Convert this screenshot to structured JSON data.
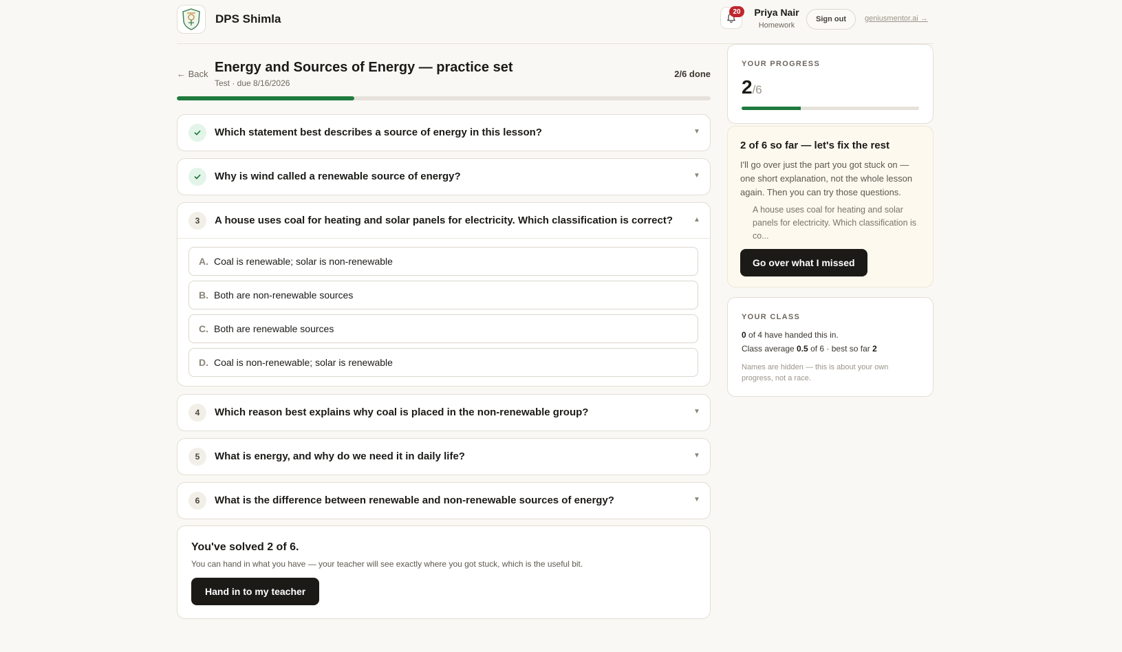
{
  "header": {
    "school_name": "DPS Shimla",
    "notifications_count": "20",
    "user_name": "Priya Nair",
    "user_role": "Homework",
    "sign_out_label": "Sign out",
    "brand_link": "geniusmentor.ai →"
  },
  "assignment": {
    "back_label": "← Back",
    "title": "Energy and Sources of Energy — practice set",
    "subtitle": "Test · due 8/16/2026",
    "done_label": "2/6 done",
    "progress_fraction": 0.333
  },
  "questions": [
    {
      "number": "1",
      "status": "correct",
      "text": "Which statement best describes a source of energy in this lesson?",
      "expanded": false
    },
    {
      "number": "2",
      "status": "correct",
      "text": "Why is wind called a renewable source of energy?",
      "expanded": false
    },
    {
      "number": "3",
      "status": "open",
      "text": "A house uses coal for heating and solar panels for electricity. Which classification is correct?",
      "expanded": true,
      "options": [
        {
          "letter": "A.",
          "text": "Coal is renewable; solar is non-renewable"
        },
        {
          "letter": "B.",
          "text": "Both are non-renewable sources"
        },
        {
          "letter": "C.",
          "text": "Both are renewable sources"
        },
        {
          "letter": "D.",
          "text": "Coal is non-renewable; solar is renewable"
        }
      ]
    },
    {
      "number": "4",
      "status": "open",
      "text": "Which reason best explains why coal is placed in the non-renewable group?",
      "expanded": false
    },
    {
      "number": "5",
      "status": "open",
      "text": "What is energy, and why do we need it in daily life?",
      "expanded": false
    },
    {
      "number": "6",
      "status": "open",
      "text": "What is the difference between renewable and non-renewable sources of energy?",
      "expanded": false
    }
  ],
  "summary": {
    "title": "You've solved 2 of 6.",
    "text": "You can hand in what you have — your teacher will see exactly where you got stuck, which is the useful bit.",
    "button_label": "Hand in to my teacher"
  },
  "progress_panel": {
    "label": "YOUR PROGRESS",
    "value": "2",
    "total": "/6",
    "fraction": 0.333
  },
  "help_panel": {
    "title": "2 of 6 so far — let's fix the rest",
    "text": "I'll go over just the part you got stuck on — one short explanation, not the whole lesson again. Then you can try those questions.",
    "quote": "A house uses coal for heating and solar panels for electricity. Which classification is co...",
    "button_label": "Go over what I missed"
  },
  "class_panel": {
    "label": "YOUR CLASS",
    "handed_in_count": "0",
    "handed_in_text": " of 4 have handed this in.",
    "avg_prefix": "Class average ",
    "avg_value": "0.5",
    "avg_mid": " of 6 · best so far ",
    "best_value": "2",
    "note": "Names are hidden — this is about your own progress, not a race."
  },
  "icons": {
    "check": "check-icon",
    "bell": "bell-icon",
    "chevron": "chevron-icon"
  },
  "colors": {
    "accent_green": "#1f7a3e",
    "badge_red": "#c0262d",
    "button_dark": "#1c1a17"
  }
}
